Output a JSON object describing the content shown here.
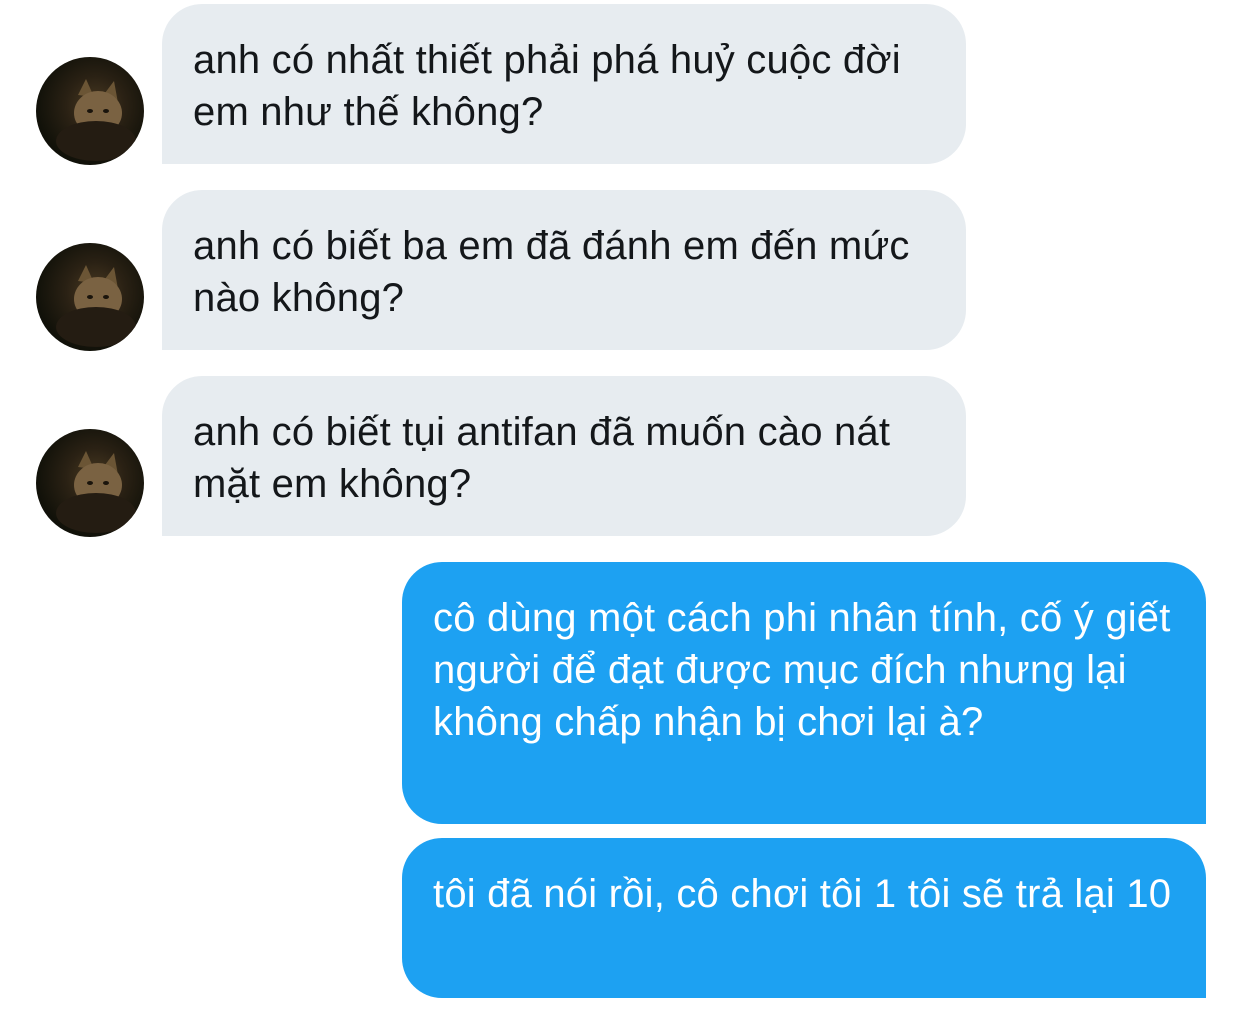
{
  "conversation": {
    "messages": [
      {
        "sender": "other",
        "text": "anh có nhất thiết phải phá huỷ cuộc đời em như thế không?"
      },
      {
        "sender": "other",
        "text": "anh có biết ba em đã đánh em đến mức nào không?"
      },
      {
        "sender": "other",
        "text": "anh có biết tụi antifan đã muốn cào nát mặt em không?"
      },
      {
        "sender": "me",
        "text": "cô dùng một cách phi nhân tính, cố ý giết người để đạt được mục đích nhưng lại không chấp nhận bị chơi lại à?"
      },
      {
        "sender": "me",
        "text": "tôi đã nói rồi, cô chơi tôi 1 tôi sẽ trả lại 10"
      }
    ]
  },
  "colors": {
    "incoming_bubble": "#e7ecf0",
    "outgoing_bubble": "#1da1f2",
    "incoming_text": "#14171a",
    "outgoing_text": "#ffffff"
  },
  "icons": {
    "avatar": "cat-photo-avatar"
  }
}
